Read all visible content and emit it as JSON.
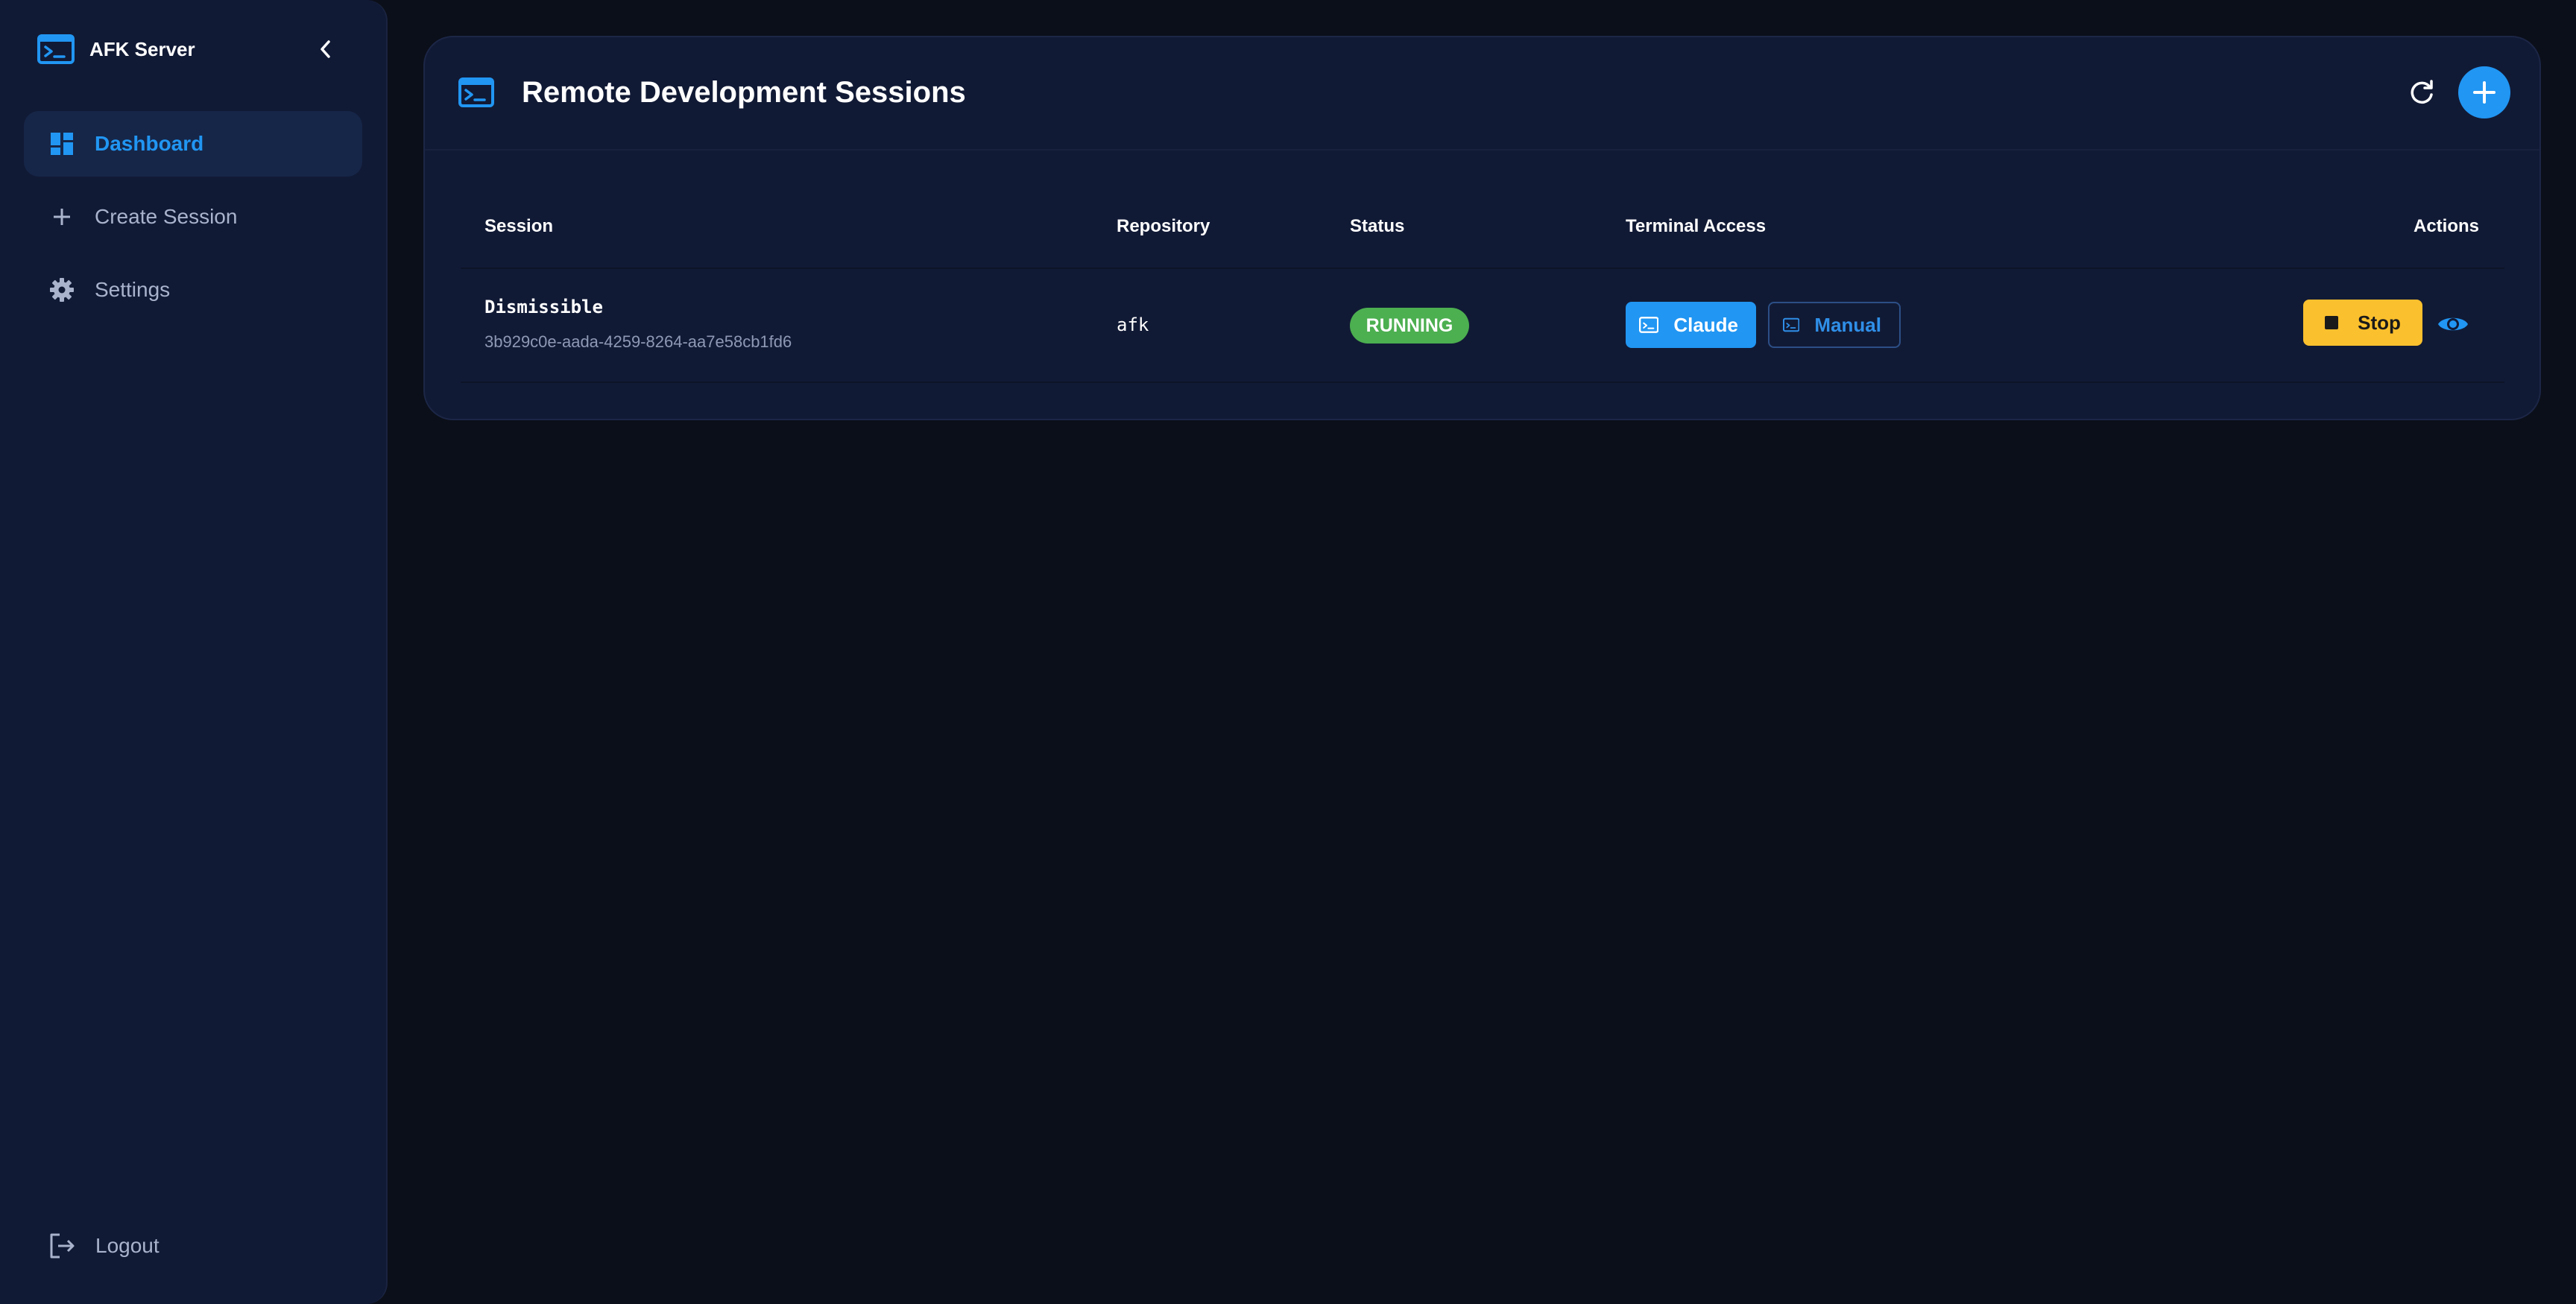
{
  "app": {
    "title": "AFK Server",
    "brand_color": "#2196f3"
  },
  "sidebar": {
    "items": [
      {
        "label": "Dashboard",
        "icon": "dashboard-icon",
        "active": true
      },
      {
        "label": "Create Session",
        "icon": "plus-icon",
        "active": false
      },
      {
        "label": "Settings",
        "icon": "gear-icon",
        "active": false
      }
    ],
    "logout_label": "Logout"
  },
  "main": {
    "title": "Remote Development Sessions",
    "table": {
      "columns": [
        "Session",
        "Repository",
        "Status",
        "Terminal Access",
        "Actions"
      ],
      "rows": [
        {
          "session_name": "Dismissible",
          "session_id": "3b929c0e-aada-4259-8264-aa7e58cb1fd6",
          "repository": "afk",
          "status": "RUNNING",
          "terminal_buttons": [
            "Claude",
            "Manual"
          ],
          "action_label": "Stop"
        }
      ]
    }
  },
  "colors": {
    "background": "#0b0f19",
    "panel": "#111a35",
    "status_running": "#4caf50",
    "stop_button": "#fbc02d"
  }
}
